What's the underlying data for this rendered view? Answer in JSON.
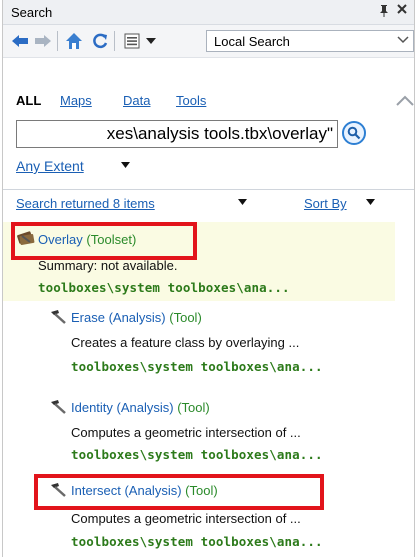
{
  "window": {
    "title": "Search",
    "pin_icon": "pin-icon",
    "close_icon": "close-icon",
    "pin_glyph": "❘",
    "close_glyph": "✕"
  },
  "toolbar": {
    "back_icon": "back-arrow-icon",
    "forward_icon": "forward-arrow-icon",
    "home_icon": "home-icon",
    "refresh_icon": "refresh-icon",
    "view_icon": "list-view-icon",
    "scope_value": "Local Search"
  },
  "filters": {
    "all": "ALL",
    "maps": "Maps",
    "data": "Data",
    "tools": "Tools"
  },
  "search": {
    "query": "xes\\analysis tools.tbx\\overlay\"",
    "extent": "Any Extent"
  },
  "results_header": {
    "status": "Search returned 8 items",
    "sort": "Sort By"
  },
  "results": [
    {
      "name": "Overlay",
      "type": "(Toolset)",
      "summary": "Summary: not available.",
      "path": "toolboxes\\system toolboxes\\ana...",
      "icon": "toolset-icon",
      "highlighted": true,
      "selected": true
    },
    {
      "name": "Erase (Analysis)",
      "type": "(Tool)",
      "summary": "Creates a feature class by overlaying ...",
      "path": "toolboxes\\system toolboxes\\ana...",
      "icon": "hammer-icon",
      "highlighted": false
    },
    {
      "name": "Identity (Analysis)",
      "type": "(Tool)",
      "summary": "Computes a geometric intersection of ...",
      "path": "toolboxes\\system toolboxes\\ana...",
      "icon": "hammer-icon",
      "highlighted": false
    },
    {
      "name": "Intersect (Analysis)",
      "type": "(Tool)",
      "summary": "Computes a geometric intersection of ...",
      "path": "toolboxes\\system toolboxes\\ana...",
      "icon": "hammer-icon",
      "highlighted": true
    }
  ],
  "colors": {
    "link": "#1a5fb4",
    "tool_type": "#2a8a2a",
    "path": "#2c7a1a",
    "highlight_box": "#e2141b",
    "selected_bg": "#fafbe3"
  }
}
